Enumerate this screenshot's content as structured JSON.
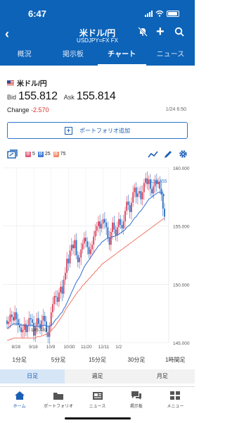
{
  "status": {
    "time": "6:47"
  },
  "header": {
    "title": "米ドル/円",
    "subtitle": "USDJPY=FX FX",
    "tabs": [
      {
        "label": "概況",
        "active": false
      },
      {
        "label": "掲示板",
        "active": false
      },
      {
        "label": "チャート",
        "active": true
      },
      {
        "label": "ニュース",
        "active": false
      }
    ]
  },
  "quote": {
    "pair": "米ドル/円",
    "bid_label": "Bid",
    "bid": "155.812",
    "ask_label": "Ask",
    "ask": "155.814",
    "change_label": "Change",
    "change": "-2.570",
    "date": "1/24 6:50",
    "portfolio_button": "ポートフォリオ追加"
  },
  "chart_toolbar": {
    "ma": [
      {
        "label": "移",
        "period": "5",
        "color": "#e25a7a"
      },
      {
        "label": "移",
        "period": "25",
        "color": "#3b78d6"
      },
      {
        "label": "移",
        "period": "75",
        "color": "#ef8b6b"
      }
    ]
  },
  "chart_data": {
    "type": "candlestick",
    "y_ticks": [
      "160.000",
      "155.000",
      "150.000",
      "145.000"
    ],
    "ylim": [
      145.0,
      160.0
    ],
    "x_ticks": [
      "8/28",
      "9/18",
      "10/9",
      "10/30",
      "11/20",
      "12/11",
      "1/2"
    ],
    "annotations": {
      "high": "159.455",
      "low": "145.483"
    },
    "ma_colors": {
      "ma5": "#e25a7a",
      "ma25": "#2f6fce",
      "ma75": "#ef6b5b"
    },
    "closes": [
      146.6,
      146.8,
      147.4,
      147.2,
      146.9,
      147.6,
      147.0,
      146.5,
      146.3,
      145.9,
      146.1,
      146.6,
      145.9,
      146.5,
      147.1,
      147.0,
      146.7,
      145.6,
      146.4,
      147.1,
      146.6,
      146.2,
      146.9,
      147.3,
      146.8,
      145.9,
      145.5,
      146.4,
      147.6,
      148.3,
      149.0,
      148.9,
      148.5,
      149.3,
      149.8,
      149.2,
      150.4,
      151.0,
      152.2,
      151.8,
      152.9,
      153.4,
      153.1,
      153.8,
      152.5,
      151.9,
      152.3,
      153.0,
      153.5,
      154.0,
      153.7,
      153.2,
      152.6,
      153.0,
      153.4,
      154.1,
      154.6,
      155.0,
      155.4,
      154.8,
      155.2,
      155.6,
      155.3,
      154.9,
      154.0,
      153.4,
      154.5,
      155.3,
      154.7,
      154.2,
      154.9,
      155.6,
      155.1,
      154.8,
      155.4,
      156.3,
      157.1,
      156.8,
      156.2,
      157.0,
      157.9,
      158.3,
      157.5,
      157.8,
      158.0,
      157.3,
      157.9,
      158.7,
      159.1,
      158.6,
      159.0,
      158.2,
      157.8,
      158.4,
      158.9,
      158.6,
      158.8,
      158.2,
      157.7,
      156.5,
      155.8
    ],
    "ma25": [
      146.2,
      146.3,
      146.4,
      146.5,
      146.6,
      146.6,
      146.6,
      146.6,
      146.6,
      146.5,
      146.5,
      146.5,
      146.4,
      146.4,
      146.5,
      146.5,
      146.5,
      146.4,
      146.4,
      146.4,
      146.4,
      146.4,
      146.4,
      146.5,
      146.5,
      146.4,
      146.4,
      146.4,
      146.5,
      146.6,
      146.8,
      147.0,
      147.1,
      147.3,
      147.5,
      147.6,
      147.9,
      148.1,
      148.4,
      148.7,
      149.0,
      149.3,
      149.6,
      149.9,
      150.2,
      150.4,
      150.6,
      150.9,
      151.2,
      151.5,
      151.7,
      151.9,
      152.1,
      152.3,
      152.5,
      152.7,
      152.9,
      153.1,
      153.3,
      153.4,
      153.6,
      153.7,
      153.8,
      153.9,
      154.0,
      154.0,
      154.0,
      154.1,
      154.1,
      154.2,
      154.2,
      154.3,
      154.4,
      154.5,
      154.6,
      154.7,
      154.9,
      155.0,
      155.1,
      155.3,
      155.5,
      155.7,
      155.8,
      156.0,
      156.2,
      156.3,
      156.5,
      156.7,
      156.9,
      157.1,
      157.3,
      157.4,
      157.5,
      157.6,
      157.7,
      157.8,
      157.9,
      157.9,
      157.9,
      157.8,
      157.6
    ],
    "ma75": [
      145.2,
      145.2,
      145.3,
      145.3,
      145.4,
      145.4,
      145.4,
      145.4,
      145.4,
      145.4,
      145.4,
      145.4,
      145.4,
      145.4,
      145.4,
      145.4,
      145.4,
      145.4,
      145.4,
      145.5,
      145.5,
      145.5,
      145.6,
      145.6,
      145.7,
      145.7,
      145.8,
      145.9,
      146.0,
      146.2,
      146.3,
      146.5,
      146.7,
      146.9,
      147.1,
      147.3,
      147.5,
      147.8,
      148.0,
      148.2,
      148.4,
      148.6,
      148.8,
      149.0,
      149.2,
      149.4,
      149.5,
      149.7,
      149.9,
      150.0,
      150.2,
      150.3,
      150.5,
      150.6,
      150.8,
      150.9,
      151.1,
      151.2,
      151.4,
      151.5,
      151.7,
      151.8,
      151.9,
      152.0,
      152.1,
      152.2,
      152.3,
      152.4,
      152.5,
      152.6,
      152.7,
      152.8,
      152.9,
      153.0,
      153.1,
      153.2,
      153.3,
      153.4,
      153.5,
      153.6,
      153.7,
      153.8,
      153.9,
      154.0,
      154.1,
      154.2,
      154.3,
      154.4,
      154.5,
      154.6,
      154.7,
      154.8,
      154.9,
      155.0,
      155.1,
      155.2,
      155.3,
      155.4,
      155.5,
      155.6,
      155.7
    ]
  },
  "periods": [
    "1分足",
    "5分足",
    "15分足",
    "30分足",
    "1時間足"
  ],
  "ranges": [
    {
      "label": "日足",
      "active": true
    },
    {
      "label": "週足",
      "active": false
    },
    {
      "label": "月足",
      "active": false
    }
  ],
  "nav": [
    {
      "label": "ホーム",
      "icon": "home-icon",
      "active": true
    },
    {
      "label": "ポートフォリオ",
      "icon": "folder-icon",
      "active": false
    },
    {
      "label": "ニュース",
      "icon": "news-icon",
      "active": false
    },
    {
      "label": "掲示板",
      "icon": "board-icon",
      "active": false
    },
    {
      "label": "メニュー",
      "icon": "menu-icon",
      "active": false
    }
  ]
}
